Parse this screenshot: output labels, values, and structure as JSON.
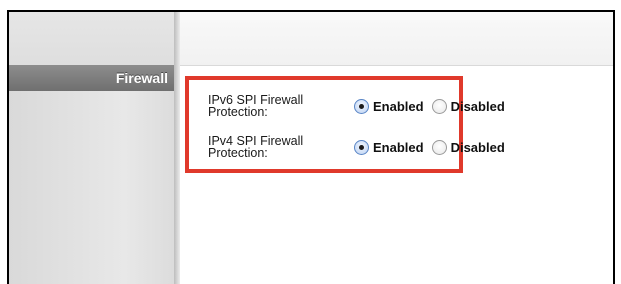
{
  "section": {
    "title": "Firewall"
  },
  "firewall": {
    "rows": [
      {
        "label": "IPv6 SPI Firewall Protection:",
        "enabled_label": "Enabled",
        "disabled_label": "Disabled",
        "selected": "Enabled"
      },
      {
        "label": "IPv4 SPI Firewall Protection:",
        "enabled_label": "Enabled",
        "disabled_label": "Disabled",
        "selected": "Enabled"
      }
    ]
  },
  "colors": {
    "highlight_border": "#e0392b",
    "section_bar": "#7a7a7a",
    "radio_selected": "#5a86c6"
  }
}
